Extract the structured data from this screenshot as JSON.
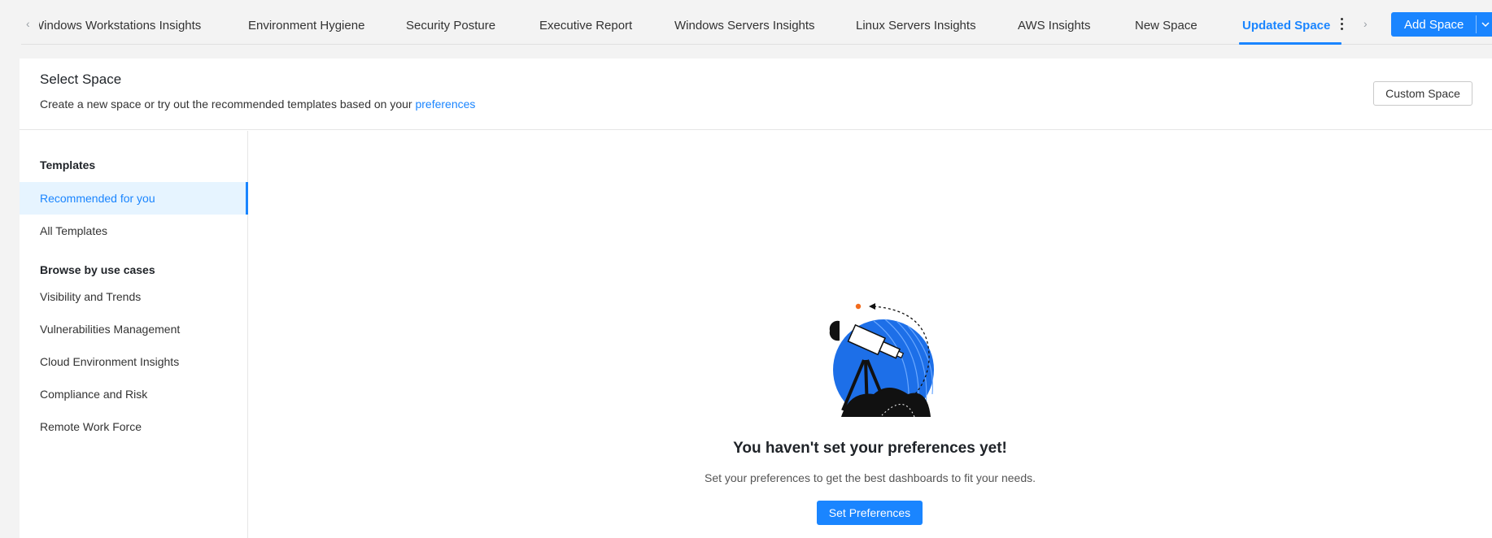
{
  "tabs": [
    {
      "label": "Windows Workstations Insights",
      "active": false
    },
    {
      "label": "Environment Hygiene",
      "active": false
    },
    {
      "label": "Security Posture",
      "active": false
    },
    {
      "label": "Executive Report",
      "active": false
    },
    {
      "label": "Windows Servers Insights",
      "active": false
    },
    {
      "label": "Linux Servers Insights",
      "active": false
    },
    {
      "label": "AWS Insights",
      "active": false
    },
    {
      "label": "New Space",
      "active": false
    },
    {
      "label": "Updated Space",
      "active": true
    }
  ],
  "add_space_label": "Add Space",
  "panel": {
    "title": "Select Space",
    "subtitle_prefix": "Create a new space or try out the recommended templates based on your",
    "subtitle_link": "preferences",
    "custom_space_label": "Custom Space"
  },
  "sidebar": {
    "templates_heading": "Templates",
    "templates": [
      {
        "label": "Recommended for you",
        "active": true
      },
      {
        "label": "All Templates",
        "active": false
      }
    ],
    "usecases_heading": "Browse by use cases",
    "usecases": [
      {
        "label": "Visibility and Trends"
      },
      {
        "label": "Vulnerabilities Management"
      },
      {
        "label": "Cloud Environment Insights"
      },
      {
        "label": "Compliance and Risk"
      },
      {
        "label": "Remote Work Force"
      }
    ]
  },
  "empty_state": {
    "title": "You haven't set your preferences yet!",
    "subtitle": "Set your preferences to get the best dashboards to fit your needs.",
    "button_label": "Set Preferences"
  },
  "colors": {
    "accent": "#1a85ff",
    "illustration_blue": "#1d6fe8",
    "illustration_dot": "#f26b1d"
  },
  "icons": [
    "chevron-left-icon",
    "chevron-right-icon",
    "kebab-menu-icon",
    "chevron-down-icon",
    "telescope-illustration"
  ]
}
